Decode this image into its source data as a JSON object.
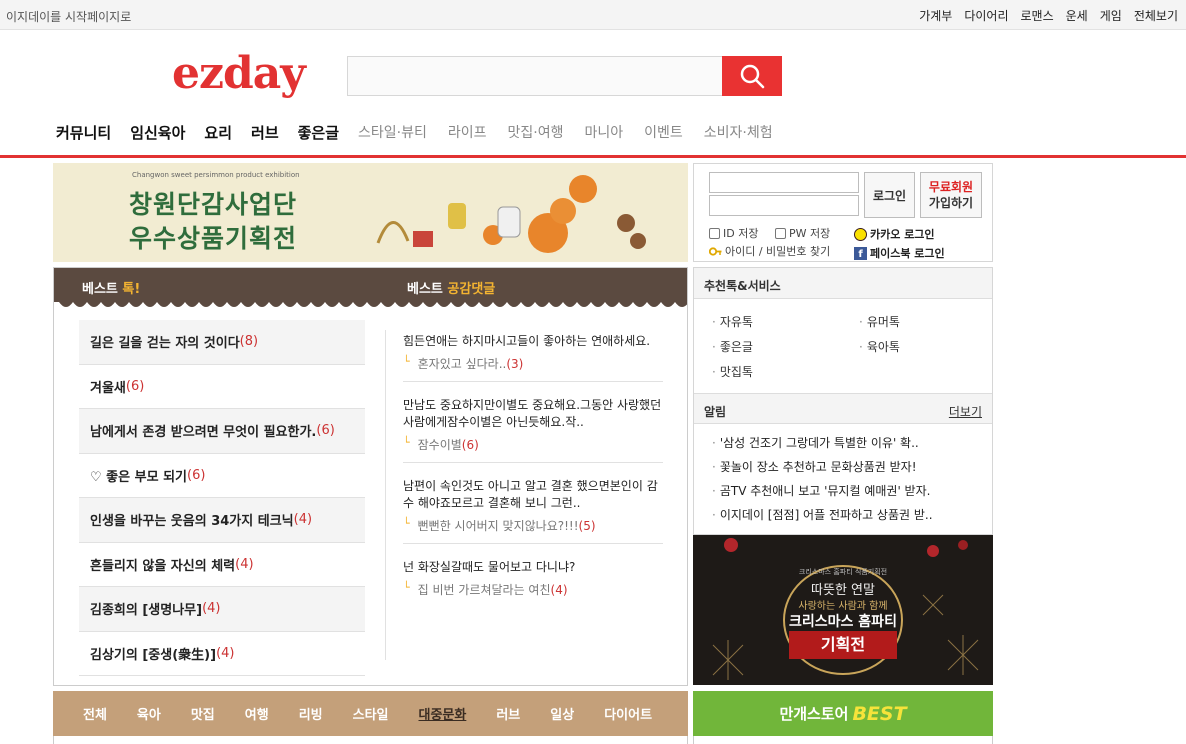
{
  "topbar": {
    "start_page": "이지데이를 시작페이지로",
    "links": [
      "가계부",
      "다이어리",
      "로맨스",
      "운세",
      "게임",
      "전체보기"
    ]
  },
  "header": {
    "logo": "ezday",
    "search_placeholder": ""
  },
  "gnb": {
    "main": [
      "커뮤니티",
      "임신육아",
      "요리",
      "러브",
      "좋은글"
    ],
    "sub": [
      "스타일·뷰티",
      "라이프",
      "맛집·여행",
      "마니아",
      "이벤트",
      "소비자·체험"
    ]
  },
  "banner": {
    "small": "Changwon sweet persimmon product exhibition",
    "line1": "창원단감사업단",
    "line2": "우수상품기획전"
  },
  "login": {
    "login_btn": "로그인",
    "join_line1": "무료회원",
    "join_line2": "가입하기",
    "save_id": "ID 저장",
    "save_pw": "PW 저장",
    "find": "아이디 / 비밀번호 찾기",
    "kakao": "카카오 로그인",
    "facebook": "페이스북 로그인"
  },
  "best": {
    "talk_title_a": "베스트",
    "talk_title_b": "톡!",
    "reply_title_a": "베스트",
    "reply_title_b": "공감댓글",
    "talks": [
      {
        "title": "길은 길을 걷는 자의 것이다",
        "count": "(8)"
      },
      {
        "title": "겨울새",
        "count": "(6)"
      },
      {
        "title": "남에게서 존경 받으려면 무엇이 필요한가.",
        "count": "(6)"
      },
      {
        "title": "♡ 좋은 부모 되기",
        "count": "(6)"
      },
      {
        "title": "인생을 바꾸는 웃음의 34가지 테크닉",
        "count": "(4)"
      },
      {
        "title": "흔들리지 않을 자신의 체력",
        "count": "(4)"
      },
      {
        "title": "김종희의 [생명나무]",
        "count": "(4)"
      },
      {
        "title": "김상기의 [중생(衆生)]",
        "count": "(4)"
      }
    ],
    "replies": [
      {
        "q": "힘든연애는 하지마시고들이 좋아하는 연애하세요.",
        "a": "혼자있고 싶다라..",
        "count": "(3)"
      },
      {
        "q": "만남도 중요하지만이별도 중요해요.그동안 사랑했던사람에게잠수이별은 아닌듯해요.작..",
        "a": "잠수이별",
        "count": "(6)"
      },
      {
        "q": "남편이 속인것도 아니고 알고 결혼 했으면본인이 감수 해야죠모르고 결혼해 보니 그런..",
        "a": "뻔뻔한 시어버지 맞지않나요?!!!",
        "count": "(5)"
      },
      {
        "q": "넌 화장실갈때도 물어보고 다니냐?",
        "a": "집 비번 가르쳐달라는 여친",
        "count": "(4)"
      }
    ]
  },
  "side": {
    "service_title": "추천톡&서비스",
    "services": [
      "자유톡",
      "유머톡",
      "좋은글",
      "육아톡",
      "맛집톡"
    ],
    "notice_title": "알림",
    "more": "더보기",
    "notices": [
      "'삼성 건조기 그랑데가 특별한 이유' 확..",
      "꽃놀이 장소 추천하고 문화상품권 받자!",
      "곰TV 추천애니 보고 '뮤지컬 예매권' 받자.",
      "이지데이 [점점] 어플 전파하고 상품권 받.."
    ]
  },
  "xmas": {
    "top": "크리스마스 홈파티 식품기획전",
    "l1": "따뜻한 연말",
    "l2": "사랑하는 사람과 함께",
    "l3": "크리스마스 홈파티",
    "l4": "기획전"
  },
  "categories": [
    "전체",
    "육아",
    "맛집",
    "여행",
    "리빙",
    "스타일",
    "대중문화",
    "러브",
    "일상",
    "다이어트"
  ],
  "active_category": "대중문화",
  "store": {
    "k": "만개스토어",
    "e": "BEST"
  },
  "colors": {
    "brand": "#e23232",
    "best_bar": "#5b4a40",
    "accent_yellow": "#f4b431",
    "cat_bar": "#c4a07a",
    "store_green": "#71b63a"
  }
}
